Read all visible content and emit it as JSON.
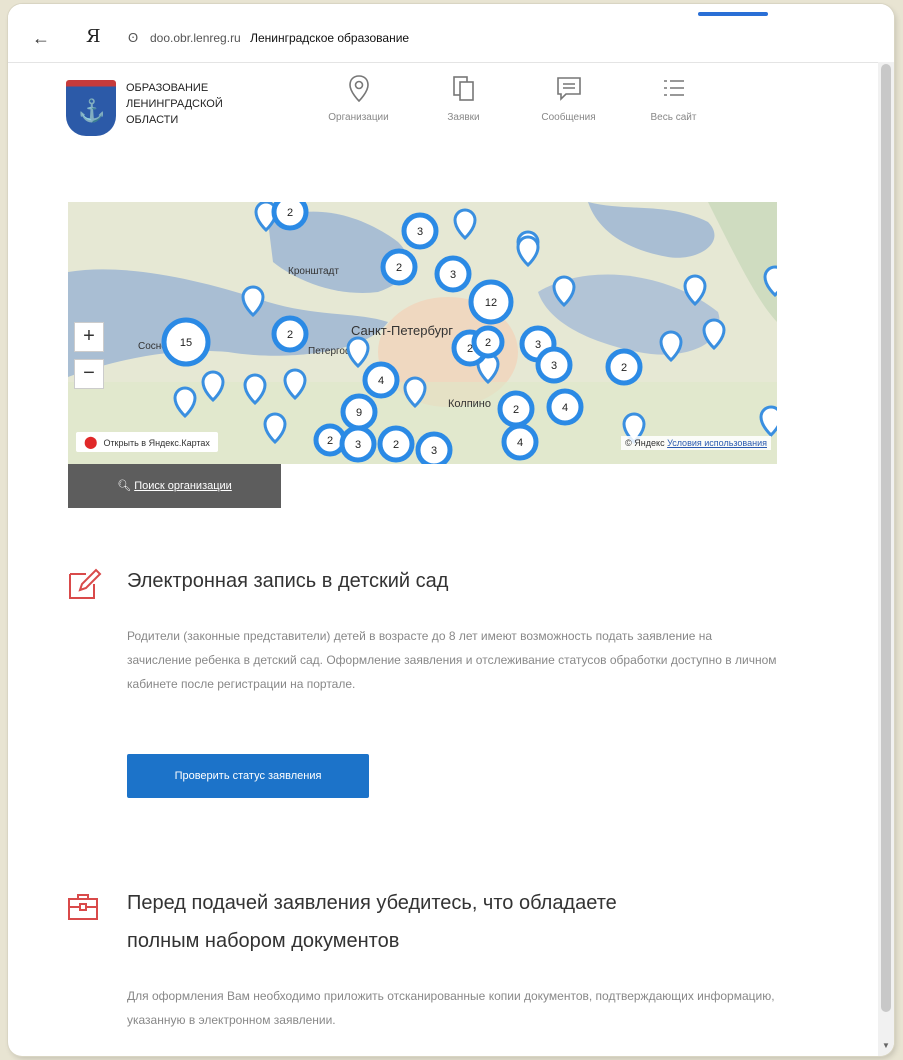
{
  "browser": {
    "back": "←",
    "yandex": "Я",
    "reload": "ʘ",
    "url": "doo.obr.lenreg.ru",
    "page_title": "Ленинградское образование"
  },
  "header": {
    "logo_lines": [
      "ОБРАЗОВАНИЕ",
      "ЛЕНИНГРАДСКОЙ",
      "ОБЛАСТИ"
    ],
    "nav": [
      {
        "label": "Организации",
        "icon": "location-pin-icon"
      },
      {
        "label": "Заявки",
        "icon": "documents-icon"
      },
      {
        "label": "Сообщения",
        "icon": "message-icon"
      },
      {
        "label": "Весь сайт",
        "icon": "list-icon"
      }
    ]
  },
  "map": {
    "zoom_in": "+",
    "zoom_out": "−",
    "open_yandex": "Открыть в Яндекс.Картах",
    "copyright": "© Яндекс",
    "terms": "Условия использования",
    "labels": [
      "Санкт-Петербург",
      "Сосновый Бор",
      "Петергоф",
      "Кронштадт",
      "Колпино"
    ],
    "clusters": [
      "2",
      "3",
      "2",
      "3",
      "12",
      "15",
      "2",
      "2",
      "2",
      "3",
      "3",
      "2",
      "4",
      "9",
      "2",
      "4",
      "2",
      "3",
      "2",
      "3",
      "4"
    ]
  },
  "search_button": "Поиск организации",
  "section1": {
    "title": "Электронная запись в детский сад",
    "text": "Родители (законные представители) детей в возрасте до 8 лет имеют возможность подать заявление на зачисление ребенка в детский сад. Оформление заявления и отслеживание статусов обработки доступно в личном кабинете после регистрации на портале.",
    "button": "Проверить статус заявления"
  },
  "section2": {
    "title_line1": "Перед подачей заявления убедитесь, что обладаете",
    "title_line2": "полным набором документов",
    "text": "Для оформления Вам необходимо приложить отсканированные копии документов, подтверждающих информацию, указанную в электронном заявлении."
  }
}
